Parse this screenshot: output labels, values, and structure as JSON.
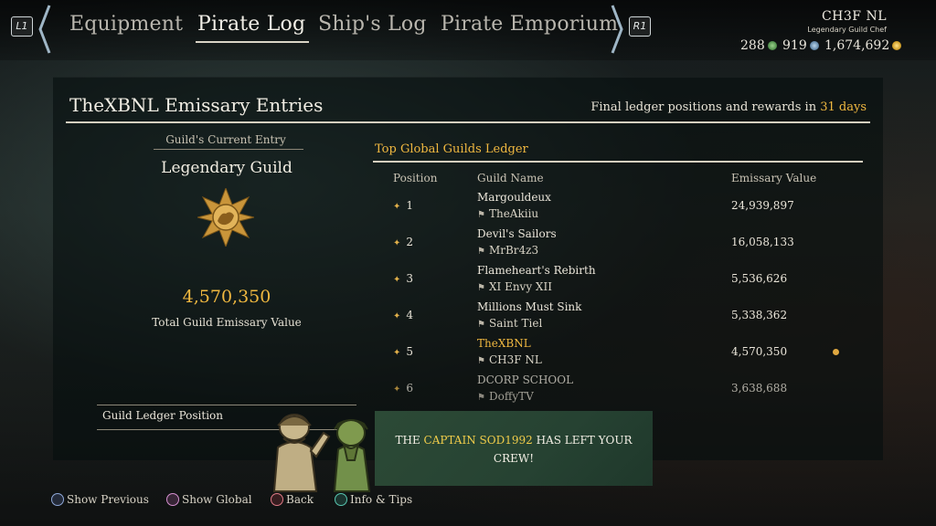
{
  "nav": {
    "left_bumper": "L1",
    "right_bumper": "R1",
    "tabs": [
      "Equipment",
      "Pirate Log",
      "Ship's Log",
      "Pirate Emporium"
    ],
    "active_tab": "Pirate Log"
  },
  "player": {
    "name": "CH3F NL",
    "title": "Legendary Guild Chef",
    "doubloons": "288",
    "ancient_coins": "919",
    "gold": "1,674,692"
  },
  "panel": {
    "title": "TheXBNL Emissary Entries",
    "ledger_note_prefix": "Final ledger positions and rewards in",
    "ledger_note_days": "31 days"
  },
  "entry": {
    "heading": "Guild's Current Entry",
    "name": "Legendary Guild",
    "emblem_icon": "guild-emblem-icon",
    "total_value": "4,570,350",
    "total_label": "Total Guild Emissary Value",
    "ledger_position_label": "Guild Ledger Position"
  },
  "ledger": {
    "title": "Top Global Guilds Ledger",
    "columns": [
      "Position",
      "Guild Name",
      "Emissary Value"
    ],
    "rows": [
      {
        "position": "1",
        "guild": "Margouldeux",
        "captain": "TheAkiiu",
        "value": "24,939,897"
      },
      {
        "position": "2",
        "guild": "Devil's Sailors",
        "captain": "MrBr4z3",
        "value": "16,058,133"
      },
      {
        "position": "3",
        "guild": "Flameheart's Rebirth",
        "captain": "XI Envy XII",
        "value": "5,536,626"
      },
      {
        "position": "4",
        "guild": "Millions Must Sink",
        "captain": "Saint Tiel",
        "value": "5,338,362"
      },
      {
        "position": "5",
        "guild": "TheXBNL",
        "captain": "CH3F NL",
        "value": "4,570,350"
      },
      {
        "position": "6",
        "guild": "DCORP SCHOOL",
        "captain": "DoffyTV",
        "value": "3,638,688"
      }
    ]
  },
  "toast": {
    "prefix": "THE",
    "name": "CAPTAIN SOD1992",
    "suffix": "HAS LEFT YOUR CREW!"
  },
  "prompts": {
    "show_previous": "Show Previous",
    "show_global": "Show Global",
    "back": "Back",
    "info_tips": "Info & Tips"
  },
  "colors": {
    "accent_gold": "#f0b840",
    "toast_green": "#2c4a36"
  }
}
